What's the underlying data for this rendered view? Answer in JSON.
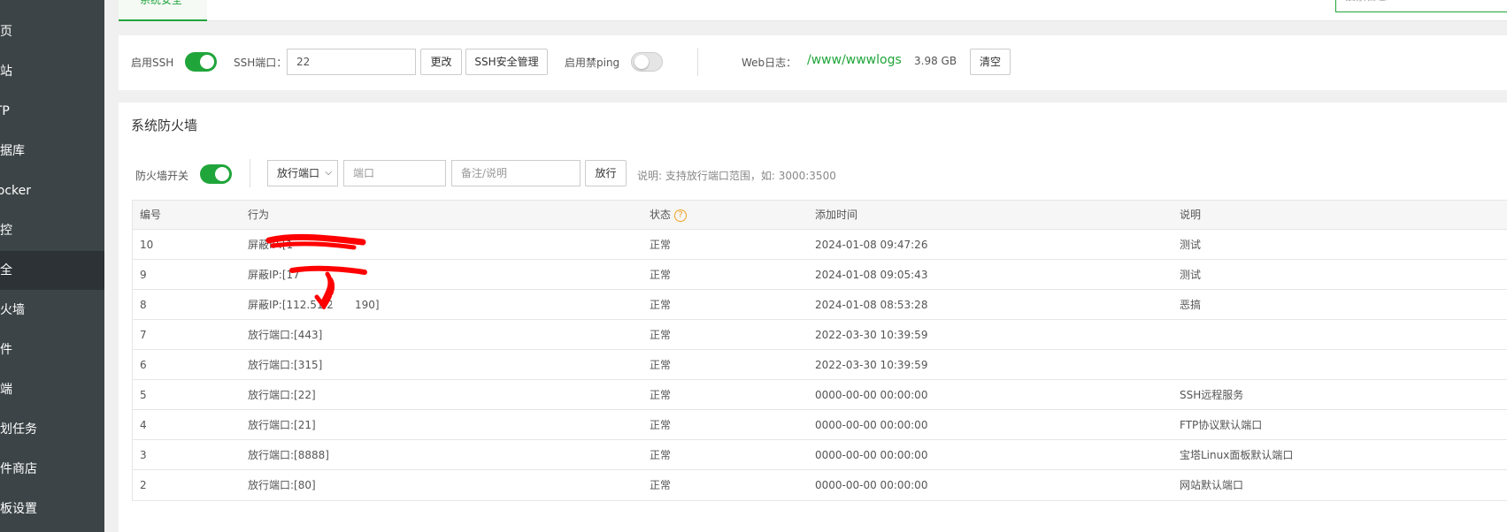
{
  "sidebar": {
    "items": [
      {
        "label": "首页"
      },
      {
        "label": "网站"
      },
      {
        "label": "FTP"
      },
      {
        "label": "数据库"
      },
      {
        "label": "Docker"
      },
      {
        "label": "监控"
      },
      {
        "label": "安全"
      },
      {
        "label": "防火墙"
      },
      {
        "label": "文件"
      },
      {
        "label": "终端"
      },
      {
        "label": "计划任务"
      },
      {
        "label": "软件商店"
      },
      {
        "label": "面板设置"
      }
    ]
  },
  "header": {
    "tab_label": "系统安全",
    "search_placeholder": "搜索日志"
  },
  "ssh": {
    "enable_label": "启用SSH",
    "port_label": "SSH端口：",
    "port_value": "22",
    "change_button": "更改",
    "manage_button": "SSH安全管理",
    "ping_label": "启用禁ping",
    "weblog_label": "Web日志：",
    "weblog_path": "/www/wwwlogs",
    "weblog_size": "3.98 GB",
    "clear_button": "清空"
  },
  "firewall": {
    "title": "系统防火墙",
    "switch_label": "防火墙开关",
    "select_value": "放行端口",
    "port_placeholder": "端口",
    "note_placeholder": "备注/说明",
    "submit_button": "放行",
    "hint": "说明: 支持放行端口范围，如: 3000:3500"
  },
  "table": {
    "headers": [
      "编号",
      "行为",
      "状态",
      "添加时间",
      "说明"
    ],
    "help_icon": "?",
    "rows": [
      {
        "id": "10",
        "action": "屏蔽IP:[1",
        "status": "正常",
        "time": "2024-01-08 09:47:26",
        "note": "测试"
      },
      {
        "id": "9",
        "action": "屏蔽IP:[17",
        "status": "正常",
        "time": "2024-01-08 09:05:43",
        "note": "测试"
      },
      {
        "id": "8",
        "action": "屏蔽IP:[112.51.2",
        "status": "正常",
        "time": "2024-01-08 08:53:28",
        "note": "恶搞"
      },
      {
        "id": "7",
        "action": "放行端口:[443]",
        "status": "正常",
        "time": "2022-03-30 10:39:59",
        "note": ""
      },
      {
        "id": "6",
        "action": "放行端口:[315]",
        "status": "正常",
        "time": "2022-03-30 10:39:59",
        "note": ""
      },
      {
        "id": "5",
        "action": "放行端口:[22]",
        "status": "正常",
        "time": "0000-00-00 00:00:00",
        "note": "SSH远程服务"
      },
      {
        "id": "4",
        "action": "放行端口:[21]",
        "status": "正常",
        "time": "0000-00-00 00:00:00",
        "note": "FTP协议默认端口"
      },
      {
        "id": "3",
        "action": "放行端口:[8888]",
        "status": "正常",
        "time": "0000-00-00 00:00:00",
        "note": "宝塔Linux面板默认端口"
      },
      {
        "id": "2",
        "action": "放行端口:[80]",
        "status": "正常",
        "time": "0000-00-00 00:00:00",
        "note": "网站默认端口"
      }
    ]
  },
  "colors": {
    "accent": "#20a53a",
    "sidebar_bg": "#3c4447",
    "redaction": "#ff0000"
  }
}
